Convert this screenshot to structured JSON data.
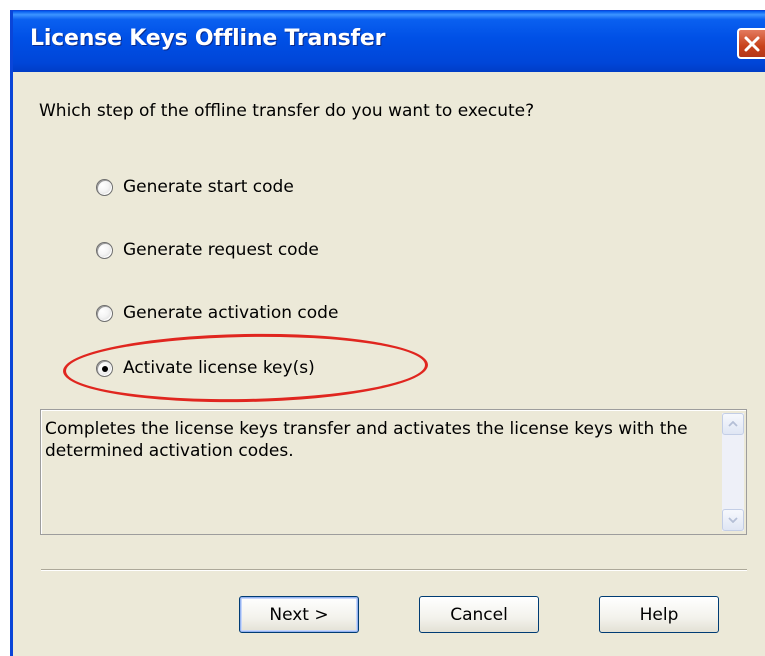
{
  "window": {
    "title": "License Keys Offline Transfer",
    "close_icon": "close-icon"
  },
  "prompt": "Which step of the offline transfer do you want to execute?",
  "options": [
    {
      "label": "Generate start code",
      "selected": false
    },
    {
      "label": "Generate request code",
      "selected": false
    },
    {
      "label": "Generate activation code",
      "selected": false
    },
    {
      "label": "Activate license key(s)",
      "selected": true
    }
  ],
  "description": "Completes the license keys transfer and activates the license keys with the determined activation codes.",
  "buttons": {
    "next": "Next >",
    "cancel": "Cancel",
    "help": "Help"
  },
  "colors": {
    "titlebar": "#0050e6",
    "dialog_bg": "#ece9d8",
    "highlight": "#e0261f",
    "close_button": "#c8421b"
  }
}
